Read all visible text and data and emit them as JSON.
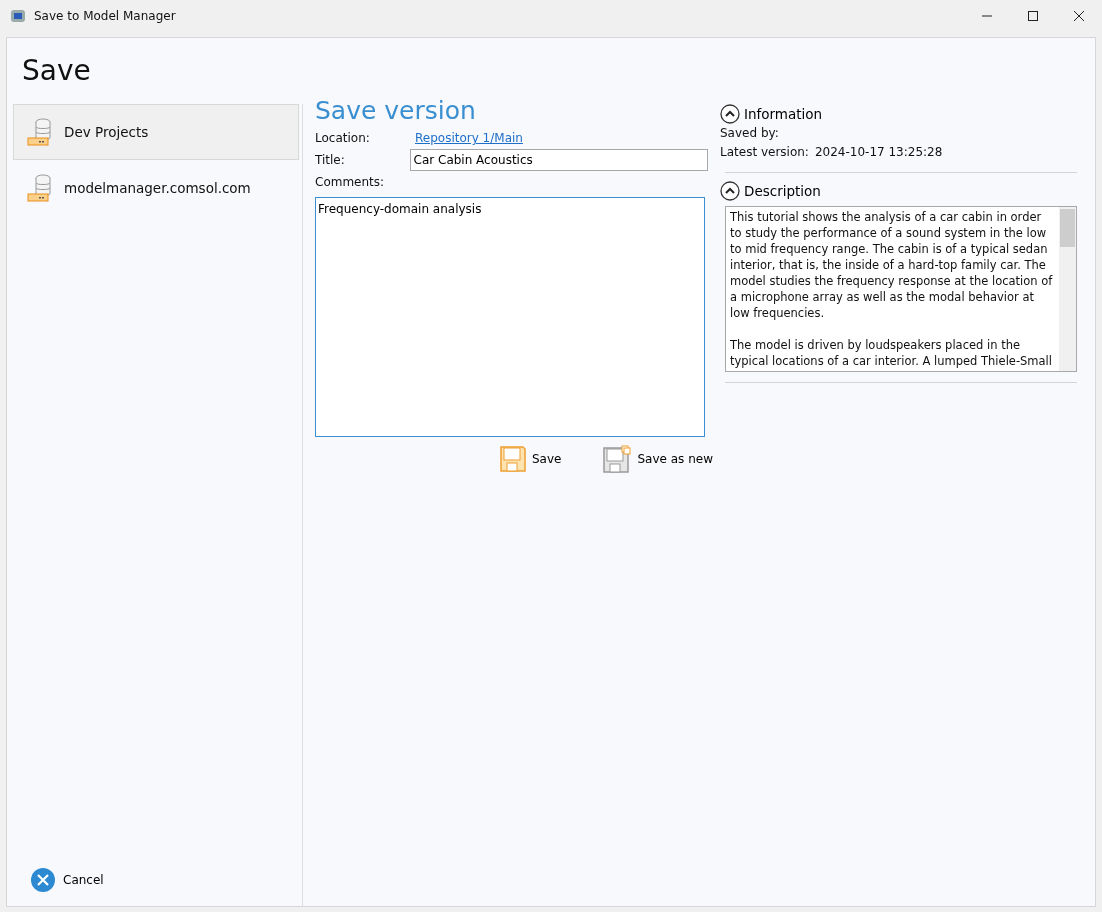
{
  "window": {
    "title": "Save to Model Manager"
  },
  "heading": "Save",
  "sidebar": {
    "items": [
      {
        "label": "Dev Projects",
        "selected": true
      },
      {
        "label": "modelmanager.comsol.com",
        "selected": false
      }
    ]
  },
  "cancel": {
    "label": "Cancel"
  },
  "form": {
    "heading": "Save version",
    "location": {
      "label": "Location:",
      "value": "Repository 1/Main"
    },
    "title": {
      "label": "Title:",
      "value": "Car Cabin Acoustics"
    },
    "comments": {
      "label": "Comments:",
      "value": "Frequency-domain analysis"
    },
    "buttons": [
      {
        "kind": "save",
        "label": "Save"
      },
      {
        "kind": "save-new",
        "label": "Save as new"
      }
    ]
  },
  "information": {
    "heading": "Information",
    "expanded": true,
    "fields": [
      {
        "label": "Saved by:"
      },
      {
        "label": "Latest version:",
        "value": "2024-10-17 13:25:28"
      }
    ]
  },
  "description": {
    "heading": "Description",
    "expanded": true,
    "paragraphs": [
      "This tutorial shows the analysis of a car cabin in order to study the performance of a sound system in the low to mid frequency range. The cabin is of a typical sedan interior, that is, the inside of a hard-top family car. The model studies the frequency response at the location of a microphone array as well as the modal behavior at low frequencies.",
      "The model is driven by loudspeakers placed in the typical locations of a car interior. A lumped Thiele-Small"
    ]
  }
}
